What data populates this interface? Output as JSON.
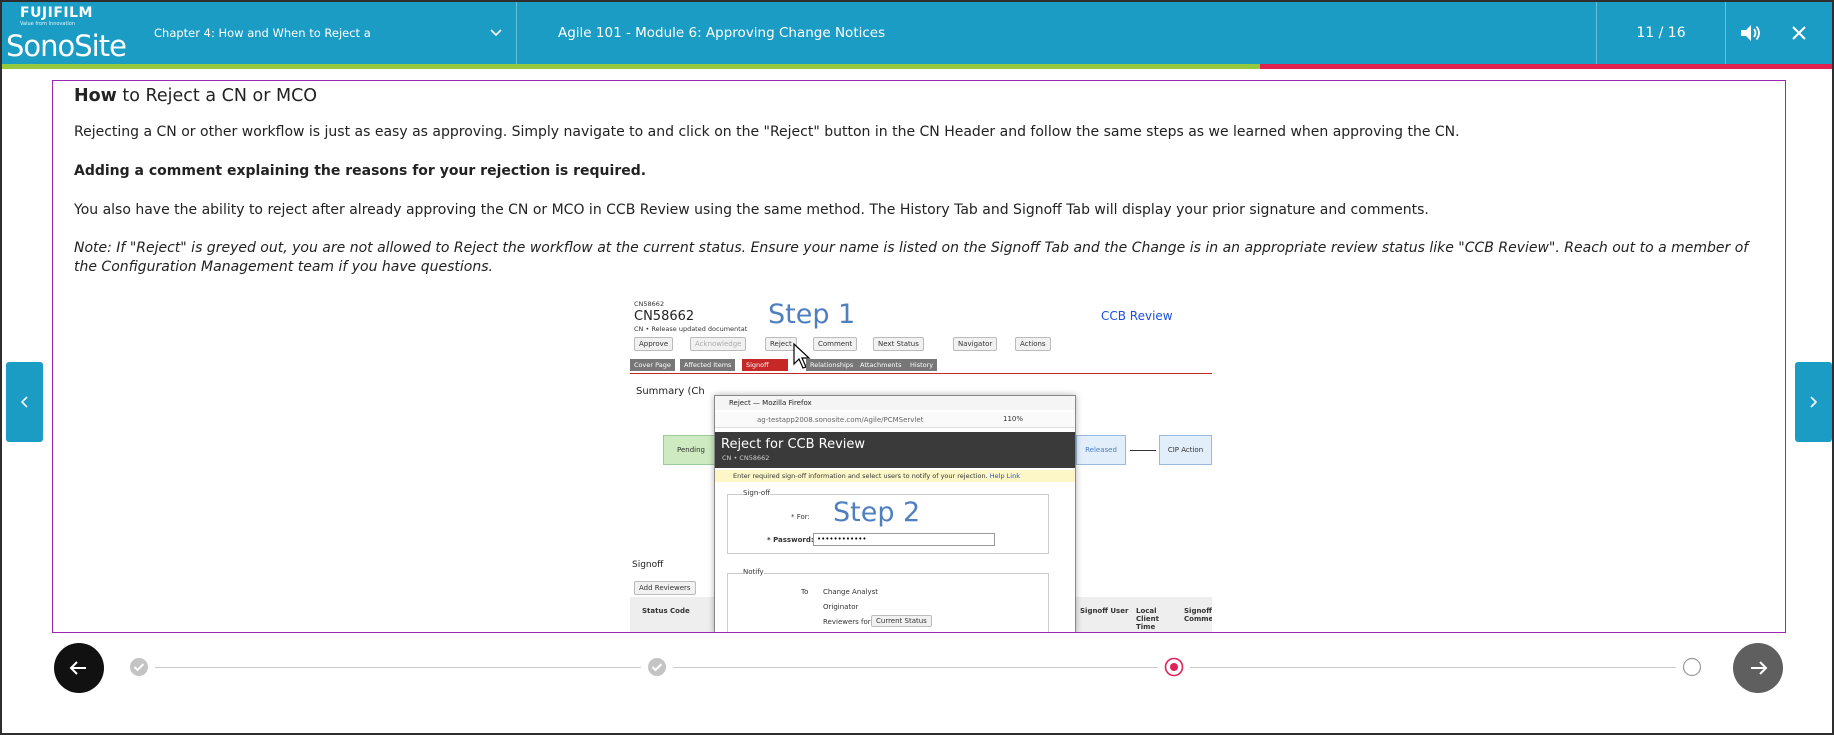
{
  "brand": {
    "company": "FUJIFILM",
    "tagline": "Value from Innovation",
    "product": "SonoSite"
  },
  "header": {
    "chapter_label": "Chapter 4: How and When to Reject a",
    "module_title": "Agile 101 - Module 6: Approving Change Notices",
    "page_counter": "11 / 16",
    "icons": [
      "chevron-down-icon",
      "volume-icon",
      "close-icon"
    ]
  },
  "progress": {
    "fraction": 0.6875,
    "color_done": "#95c93d",
    "color_remaining": "#e0224e"
  },
  "content": {
    "title_bold": "How",
    "title_rest": " to Reject a CN or MCO",
    "p1": "Rejecting a CN or other workflow is just as easy as approving.  Simply navigate to and click on the \"Reject\" button in the CN Header and follow the same steps as we learned when approving the CN.",
    "p2": "Adding a comment explaining the reasons for your rejection is required.",
    "p3": "You also have the ability to reject after already approving the CN or MCO in CCB Review using the same method.  The History Tab and Signoff Tab will display your prior signature and comments.",
    "p4": "Note:  If \"Reject\" is greyed out, you are not allowed to Reject the workflow at the current status.  Ensure your name is listed on the Signoff Tab and the Change is in an appropriate review status like \"CCB Review\".  Reach out to a member of the Configuration Management team if you have questions."
  },
  "screenshot": {
    "cn_small": "CN58662",
    "cn_big": "CN58662",
    "cn_desc": "CN • Release updated documentat",
    "step1": "Step 1",
    "status": "CCB Review",
    "buttons": [
      "Approve",
      "Acknowledge",
      "Reject",
      "Comment",
      "Next Status",
      "Navigator",
      "Actions"
    ],
    "tabs": [
      "Cover Page",
      "Affected Items",
      "Signoff",
      "Relationships",
      "Attachments",
      "History"
    ],
    "summary": "Summary  (Ch",
    "wf_pending": "Pending",
    "wf_released": "Released",
    "wf_cip": "CIP Action",
    "signoff_label": "Signoff",
    "add_reviewers": "Add Reviewers",
    "col_status_code": "Status Code",
    "col_signoff_user": "Signoff User",
    "col_local_client": "Local Client Time",
    "col_signoff_comm": "Signoff Comme",
    "dialog": {
      "window_title": "Reject — Mozilla Firefox",
      "url": "ag-testapp2008.sonosite.com/Agile/PCMServlet",
      "zoom": "110%",
      "title": "Reject for CCB Review",
      "subtitle": "CN • CN58662",
      "info": "Enter required sign-off information and select users to notify of your rejection.",
      "help_link": "Help Link",
      "signoff_group": "Sign-off",
      "for_label": "* For:",
      "password_label": "* Password:",
      "password_value": "••••••••••••",
      "step2": "Step 2",
      "notify_group": "Notify",
      "to_label": "To",
      "opt_change_analyst": "Change Analyst",
      "opt_originator": "Originator",
      "opt_reviewers_for": "Reviewers for",
      "current_status": "Current Status"
    }
  },
  "timeline": {
    "nodes": [
      "complete",
      "complete",
      "current",
      "pending"
    ],
    "accent": "#e0225a"
  }
}
